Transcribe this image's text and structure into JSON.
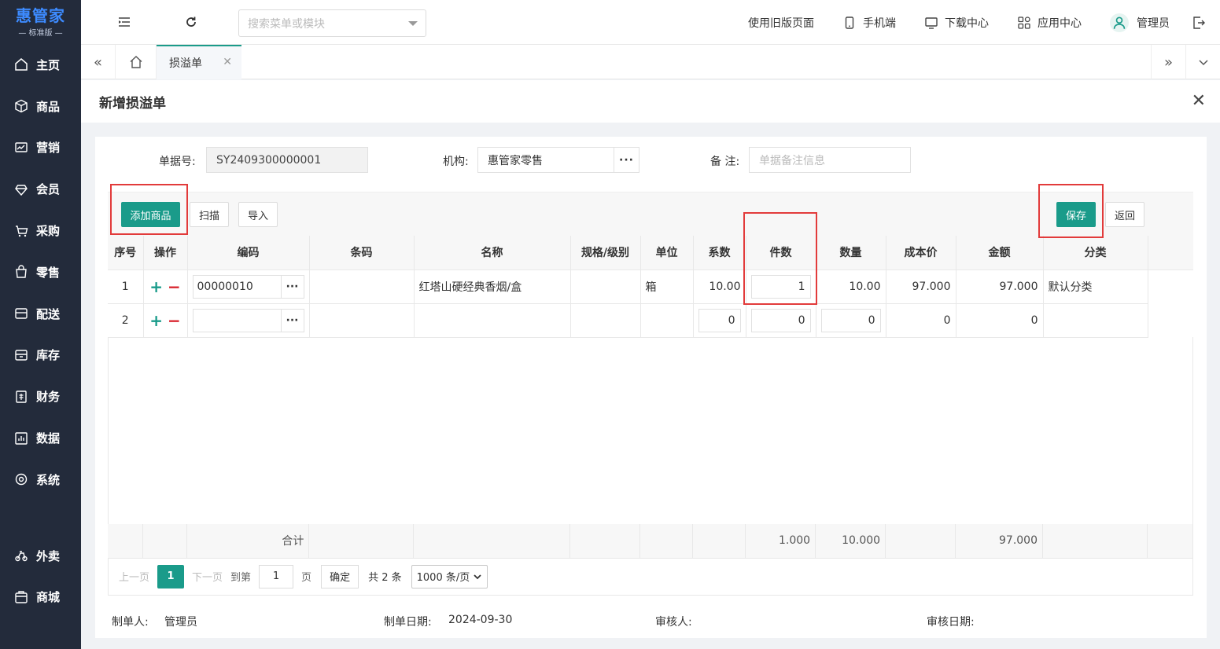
{
  "app": {
    "logo_main": "惠管家",
    "logo_sub": "— 标准版 —"
  },
  "sidebar": {
    "items": [
      {
        "label": "主页",
        "icon": "home-icon"
      },
      {
        "label": "商品",
        "icon": "box-icon"
      },
      {
        "label": "营销",
        "icon": "marketing-icon"
      },
      {
        "label": "会员",
        "icon": "member-icon"
      },
      {
        "label": "采购",
        "icon": "purchase-icon"
      },
      {
        "label": "零售",
        "icon": "retail-icon"
      },
      {
        "label": "配送",
        "icon": "delivery-icon"
      },
      {
        "label": "库存",
        "icon": "inventory-icon"
      },
      {
        "label": "财务",
        "icon": "finance-icon"
      },
      {
        "label": "数据",
        "icon": "data-icon"
      },
      {
        "label": "系统",
        "icon": "system-icon"
      },
      {
        "label": "外卖",
        "icon": "takeout-icon"
      },
      {
        "label": "商城",
        "icon": "mall-icon"
      }
    ]
  },
  "topbar": {
    "search_placeholder": "搜索菜单或模块",
    "old_page": "使用旧版页面",
    "mobile": "手机端",
    "download": "下载中心",
    "apps": "应用中心",
    "user": "管理员"
  },
  "tabs": {
    "active": "损溢单"
  },
  "page": {
    "title": "新增损溢单"
  },
  "form": {
    "doc_no_label": "单据号:",
    "doc_no_value": "SY2409300000001",
    "org_label": "机构:",
    "org_value": "惠管家零售",
    "remark_label": "备 注:",
    "remark_placeholder": "单据备注信息"
  },
  "toolbar": {
    "add_goods": "添加商品",
    "scan": "扫描",
    "import": "导入",
    "save": "保存",
    "back": "返回"
  },
  "table": {
    "headers": [
      "序号",
      "操作",
      "编码",
      "条码",
      "名称",
      "规格/级别",
      "单位",
      "系数",
      "件数",
      "数量",
      "成本价",
      "金额",
      "分类"
    ],
    "rows": [
      {
        "seq": "1",
        "code": "00000010",
        "barcode": "",
        "name": "红塔山硬经典香烟/盒",
        "spec": "",
        "unit": "箱",
        "factor": "10.00",
        "pieces": "1",
        "qty": "10.00",
        "cost": "97.000",
        "amount": "97.000",
        "category": "默认分类"
      },
      {
        "seq": "2",
        "code": "",
        "barcode": "",
        "name": "",
        "spec": "",
        "unit": "",
        "factor": "0",
        "pieces": "0",
        "qty": "0",
        "cost": "0",
        "amount": "0",
        "category": ""
      }
    ],
    "total_label": "合计",
    "total_pieces": "1.000",
    "total_qty": "10.000",
    "total_amount": "97.000"
  },
  "pager": {
    "prev": "上一页",
    "current": "1",
    "next": "下一页",
    "goto": "到第",
    "goto_value": "1",
    "page_unit": "页",
    "confirm": "确定",
    "total": "共 2 条",
    "page_size": "1000 条/页"
  },
  "footer": {
    "maker_label": "制单人:",
    "maker_value": "管理员",
    "date_label": "制单日期:",
    "date_value": "2024-09-30",
    "auditor_label": "审核人:",
    "audit_date_label": "审核日期:"
  },
  "colors": {
    "accent": "#1a9b8a",
    "sidebar_bg": "#232b3b",
    "highlight": "#e23b3b"
  }
}
